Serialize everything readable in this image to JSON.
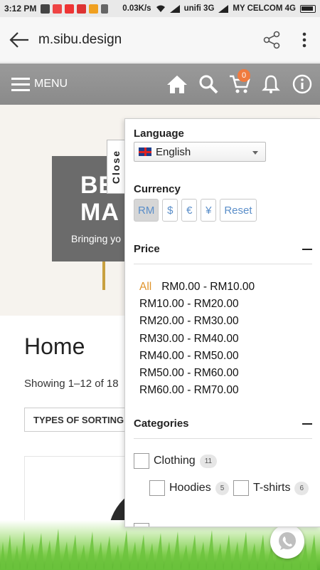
{
  "status_bar": {
    "time": "3:12 PM",
    "speed": "0.03K/s",
    "carrier1": "unifi 3G",
    "carrier2": "MY CELCOM 4G"
  },
  "browser": {
    "url": "m.sibu.design"
  },
  "nav": {
    "menu_label": "MENU",
    "cart_count": "0"
  },
  "hero": {
    "title": "BE\nMA",
    "subtitle": "Bringing yo"
  },
  "close_tab": "Close",
  "page": {
    "title": "Home",
    "showing": "Showing 1–12 of 18",
    "sorting": "TYPES OF SORTING"
  },
  "filter": {
    "language_label": "Language",
    "language_value": "English",
    "currency_label": "Currency",
    "currencies": [
      "RM",
      "$",
      "€",
      "¥"
    ],
    "reset_label": "Reset",
    "price_label": "Price",
    "price_all": "All",
    "price_ranges": [
      "RM0.00 - RM10.00",
      "RM10.00 - RM20.00",
      "RM20.00 - RM30.00",
      "RM30.00 - RM40.00",
      "RM40.00 - RM50.00",
      "RM50.00 - RM60.00",
      "RM60.00 - RM70.00"
    ],
    "categories_label": "Categories",
    "categories": [
      {
        "label": "Clothing",
        "count": "11"
      },
      {
        "label": "Hoodies",
        "count": "5"
      },
      {
        "label": "T-shirts",
        "count": "6"
      }
    ]
  },
  "colors": {
    "accent_orange": "#f07b3f",
    "link_blue": "#5a8ec9",
    "nav_gray": "#8f8f8f"
  }
}
